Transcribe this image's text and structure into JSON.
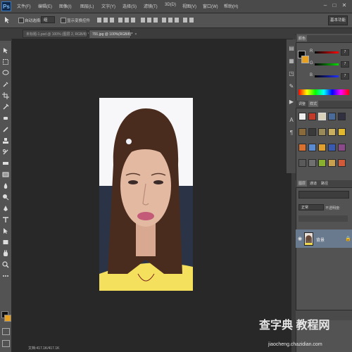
{
  "app": {
    "logo": "Ps"
  },
  "menu": {
    "items": [
      {
        "label": "文件(F)"
      },
      {
        "label": "编辑(E)"
      },
      {
        "label": "图像(I)"
      },
      {
        "label": "图层(L)"
      },
      {
        "label": "文字(Y)"
      },
      {
        "label": "选择(S)"
      },
      {
        "label": "滤镜(T)"
      },
      {
        "label": "3D(D)"
      },
      {
        "label": "视图(V)"
      },
      {
        "label": "窗口(W)"
      },
      {
        "label": "帮助(H)"
      }
    ],
    "window_controls": [
      "–",
      "□",
      "✕"
    ]
  },
  "options_bar": {
    "auto_select": "自动选择:",
    "auto_select_value": "组",
    "show_transform": "显示变换控件",
    "workspace": "基本功能"
  },
  "tabs": [
    {
      "label": "未标题-1.psd @ 100% (图层 2, RGB/8) *",
      "active": false
    },
    {
      "label": "791.jpg @ 100%(RGB/8)*",
      "active": true
    }
  ],
  "panels": {
    "color_tabs": [
      "颜色",
      "色板"
    ],
    "color_values": {
      "r": "7",
      "g": "7",
      "b": "7"
    },
    "style_tabs": [
      "调整",
      "样式"
    ],
    "layer_tabs": [
      "图层",
      "通道",
      "路径"
    ],
    "blend_mode": "正常",
    "opacity_label": "不透明度:",
    "layer_name": "背景"
  },
  "status": {
    "zoom_doc": "文档:417.1K/417.1K"
  },
  "watermarks": {
    "main": "查字典 教程网",
    "url": "jiaocheng.chazidian.com"
  },
  "colors": {
    "accent": "#3a78c0",
    "layer_selected": "#6a7a8e",
    "canvas_bg": "#282828"
  }
}
